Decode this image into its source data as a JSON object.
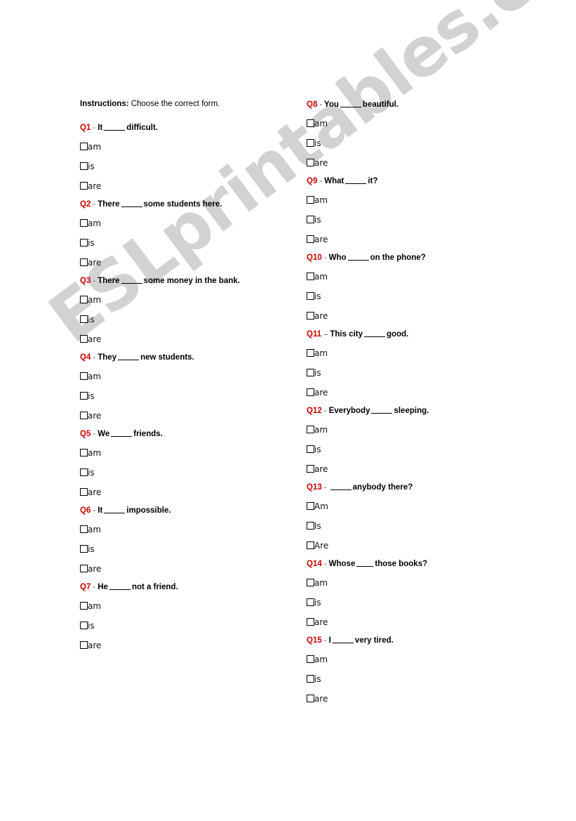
{
  "page": {
    "background_color": "#ffffff",
    "accent_color": "#cc0000",
    "watermark": "ESLprintables.com"
  },
  "instructions": {
    "lead": "Instructions:",
    "text": " Choose the correct form."
  },
  "left_column": {
    "questions": [
      {
        "number": "Q1",
        "dash": "-",
        "before": "It",
        "after": "difficult.",
        "options": [
          "am",
          "is",
          "are"
        ]
      },
      {
        "number": "Q2",
        "dash": "-",
        "before": "There",
        "after": "some students here.",
        "options": [
          "am",
          "is",
          "are"
        ]
      },
      {
        "number": "Q3",
        "dash": "-",
        "before": "There",
        "after": "some money in the bank.",
        "options": [
          "am",
          "is",
          "are"
        ]
      },
      {
        "number": "Q4",
        "dash": "-",
        "before": "They",
        "after": "new students.",
        "options": [
          "am",
          "is",
          "are"
        ]
      },
      {
        "number": "Q5",
        "dash": "-",
        "before": "We",
        "after": "friends.",
        "options": [
          "am",
          "is",
          "are"
        ]
      },
      {
        "number": "Q6",
        "dash": "-",
        "before": "It",
        "after": "impossible.",
        "options": [
          "am",
          "is",
          "are"
        ]
      },
      {
        "number": "Q7",
        "dash": "-",
        "before": "He",
        "after": "not a friend.",
        "options": [
          "am",
          "is",
          "are"
        ]
      }
    ]
  },
  "right_column": {
    "questions": [
      {
        "number": "Q8",
        "dash": "-",
        "before": "You",
        "after": "beautiful.",
        "options": [
          "am",
          "is",
          "are"
        ]
      },
      {
        "number": "Q9",
        "dash": "-",
        "before": "What",
        "after": "it?",
        "options": [
          "am",
          "is",
          "are"
        ]
      },
      {
        "number": "Q10",
        "dash": "-",
        "before": "Who",
        "after": "on the phone?",
        "options": [
          "am",
          "is",
          "are"
        ]
      },
      {
        "number": "Q11",
        "dash": "–",
        "before": "This city",
        "after": "good.",
        "options": [
          "am",
          "is",
          "are"
        ]
      },
      {
        "number": "Q12",
        "dash": "-",
        "before": "Everybody",
        "after": "sleeping.",
        "options": [
          "am",
          "is",
          "are"
        ]
      },
      {
        "number": "Q13",
        "dash": "-",
        "before": "",
        "after": "anybody there?",
        "options": [
          "Am",
          "Is",
          "Are"
        ]
      },
      {
        "number": "Q14",
        "dash": "-",
        "before": "Whose",
        "after": "those books?",
        "options": [
          "am",
          "is",
          "are"
        ]
      },
      {
        "number": "Q15",
        "dash": "-",
        "before": "I",
        "after": "very tired.",
        "options": [
          "am",
          "is",
          "are"
        ]
      }
    ]
  }
}
